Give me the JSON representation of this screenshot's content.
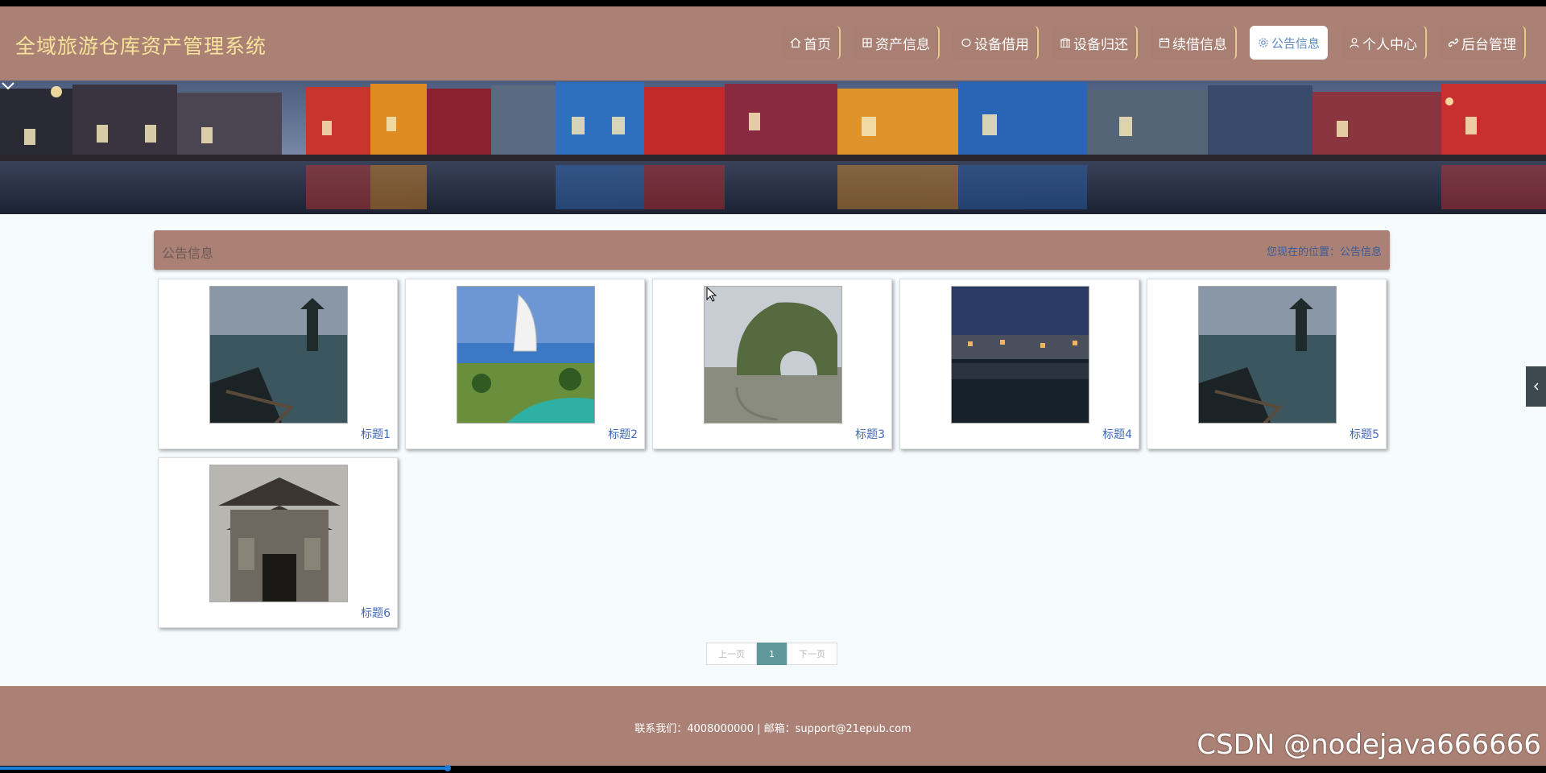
{
  "header": {
    "site_title": "全域旅游仓库资产管理系统",
    "nav": [
      {
        "label": "首页",
        "icon": "home-icon"
      },
      {
        "label": "资产信息",
        "icon": "grid-icon"
      },
      {
        "label": "设备借用",
        "icon": "circle-icon"
      },
      {
        "label": "设备归还",
        "icon": "building-icon"
      },
      {
        "label": "续借信息",
        "icon": "calendar-icon"
      },
      {
        "label": "公告信息",
        "icon": "gear-icon",
        "active": true
      },
      {
        "label": "个人中心",
        "icon": "user-icon"
      },
      {
        "label": "后台管理",
        "icon": "link-icon"
      }
    ]
  },
  "section": {
    "title": "公告信息",
    "breadcrumb_prefix": "您现在的位置：",
    "breadcrumb_current": "公告信息"
  },
  "cards": [
    {
      "title": "标题1",
      "image": "pagoda-lake-photo"
    },
    {
      "title": "标题2",
      "image": "burj-al-arab-photo"
    },
    {
      "title": "标题3",
      "image": "elephant-trunk-hill-photo"
    },
    {
      "title": "标题4",
      "image": "night-village-reflection-photo"
    },
    {
      "title": "标题5",
      "image": "pagoda-lake-photo"
    },
    {
      "title": "标题6",
      "image": "ancient-gate-photo"
    }
  ],
  "pagination": {
    "prev": "上一页",
    "current": "1",
    "next": "下一页"
  },
  "footer": {
    "text": "联系我们：4008000000 | 邮箱：support@21epub.com"
  },
  "watermark": "CSDN @nodejava666666",
  "colors": {
    "header_bg": "#ab8175",
    "title_color": "#f7e39a",
    "link": "#4169b8",
    "page_active": "#5f979b"
  }
}
